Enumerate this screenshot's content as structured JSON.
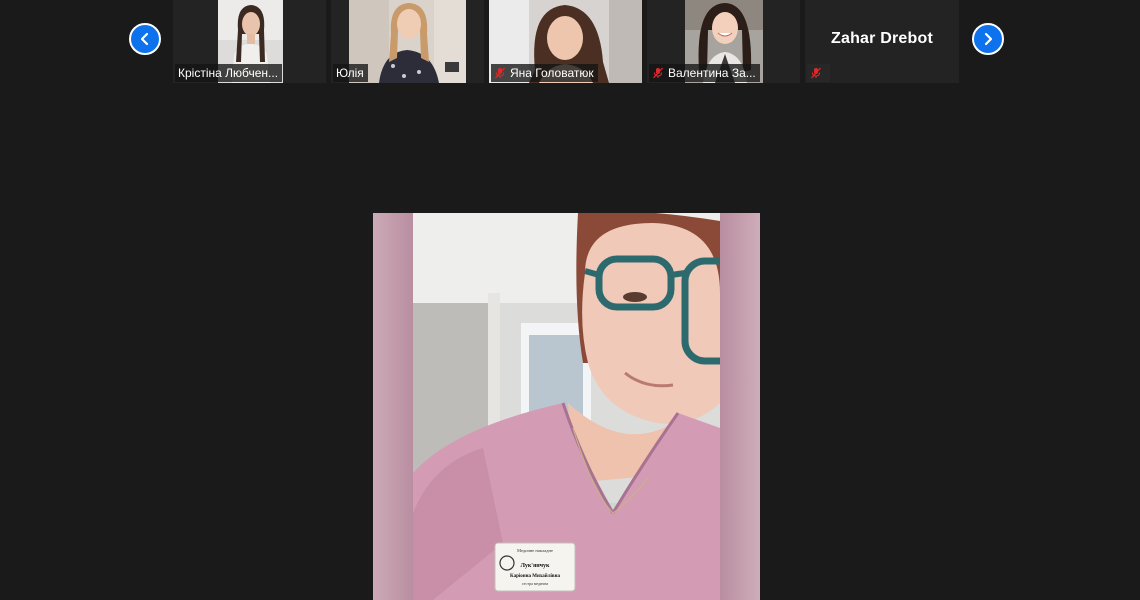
{
  "gallery": {
    "participants": [
      {
        "name": "Крістіна Любчен...",
        "muted": false
      },
      {
        "name": "Юлія",
        "muted": false
      },
      {
        "name": "Яна Головатюк",
        "muted": true
      },
      {
        "name": "Валентина За...",
        "muted": true
      },
      {
        "name": "",
        "display_name": "Zahar Drebot",
        "muted": true
      }
    ]
  },
  "badge": {
    "line1": "Медичне накладне",
    "line2": "Лук'янчук",
    "line3": "Каріонна Михайлівна",
    "line4": "сестра медична"
  },
  "colors": {
    "background": "#1a1a1a",
    "nav_button": "#0e72ed",
    "mute_red": "#e02828"
  }
}
